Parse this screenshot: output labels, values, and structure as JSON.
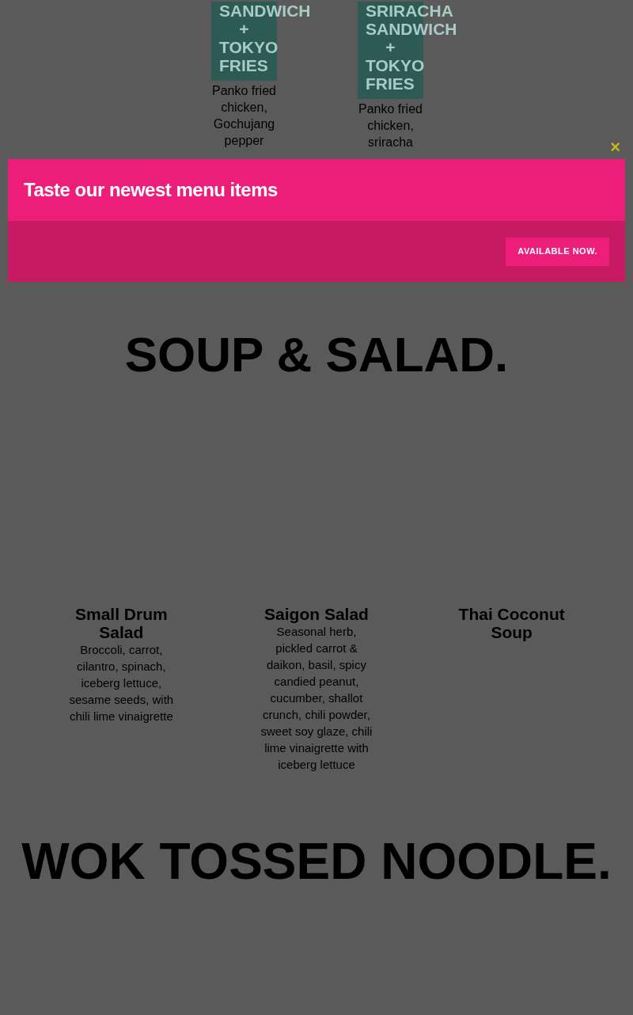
{
  "top_items": [
    {
      "title_lines": [
        "SANDWICH",
        "+",
        "TOKYO",
        "FRIES"
      ],
      "description": "Panko fried chicken, Gochujang pepper"
    },
    {
      "title_lines": [
        "SRIRACHA",
        "SANDWICH",
        "+",
        "TOKYO",
        "FRIES"
      ],
      "description": "Panko fried chicken, sriracha"
    }
  ],
  "sections": [
    {
      "heading": "SOUP & SALAD.",
      "items": [
        {
          "name": "Small Drum Salad",
          "description": "Broccoli, carrot, cilantro, spinach, iceberg lettuce, sesame seeds, with chili lime vinaigrette"
        },
        {
          "name": "Saigon Salad",
          "description": "Seasonal herb, pickled carrot & daikon, basil, spicy candied peanut, cucumber, shallot crunch, chili powder, sweet soy glaze, chili lime vinaigrette with iceberg lettuce"
        },
        {
          "name": "Thai Coconut Soup"
        }
      ]
    },
    {
      "heading": "WOK TOSSED NOODLE."
    }
  ],
  "modal": {
    "close": "×",
    "title": "Taste our newest menu items",
    "button": "AVAILABLE NOW."
  }
}
